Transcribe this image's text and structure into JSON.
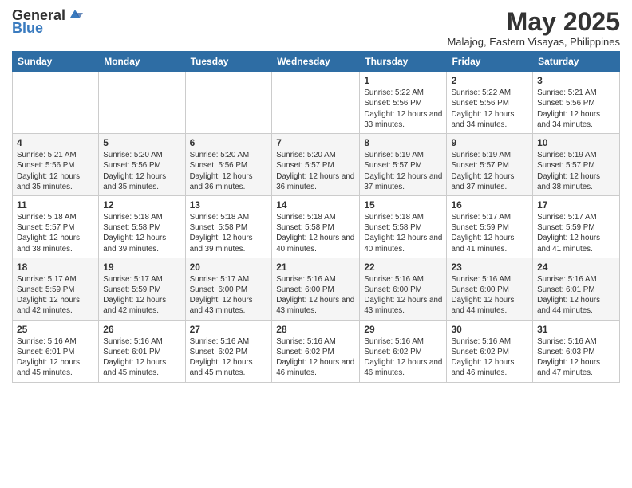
{
  "header": {
    "logo_general": "General",
    "logo_blue": "Blue",
    "title": "May 2025",
    "subtitle": "Malajog, Eastern Visayas, Philippines"
  },
  "days_of_week": [
    "Sunday",
    "Monday",
    "Tuesday",
    "Wednesday",
    "Thursday",
    "Friday",
    "Saturday"
  ],
  "weeks": [
    [
      {
        "day": "",
        "info": ""
      },
      {
        "day": "",
        "info": ""
      },
      {
        "day": "",
        "info": ""
      },
      {
        "day": "",
        "info": ""
      },
      {
        "day": "1",
        "info": "Sunrise: 5:22 AM\nSunset: 5:56 PM\nDaylight: 12 hours and 33 minutes."
      },
      {
        "day": "2",
        "info": "Sunrise: 5:22 AM\nSunset: 5:56 PM\nDaylight: 12 hours and 34 minutes."
      },
      {
        "day": "3",
        "info": "Sunrise: 5:21 AM\nSunset: 5:56 PM\nDaylight: 12 hours and 34 minutes."
      }
    ],
    [
      {
        "day": "4",
        "info": "Sunrise: 5:21 AM\nSunset: 5:56 PM\nDaylight: 12 hours and 35 minutes."
      },
      {
        "day": "5",
        "info": "Sunrise: 5:20 AM\nSunset: 5:56 PM\nDaylight: 12 hours and 35 minutes."
      },
      {
        "day": "6",
        "info": "Sunrise: 5:20 AM\nSunset: 5:56 PM\nDaylight: 12 hours and 36 minutes."
      },
      {
        "day": "7",
        "info": "Sunrise: 5:20 AM\nSunset: 5:57 PM\nDaylight: 12 hours and 36 minutes."
      },
      {
        "day": "8",
        "info": "Sunrise: 5:19 AM\nSunset: 5:57 PM\nDaylight: 12 hours and 37 minutes."
      },
      {
        "day": "9",
        "info": "Sunrise: 5:19 AM\nSunset: 5:57 PM\nDaylight: 12 hours and 37 minutes."
      },
      {
        "day": "10",
        "info": "Sunrise: 5:19 AM\nSunset: 5:57 PM\nDaylight: 12 hours and 38 minutes."
      }
    ],
    [
      {
        "day": "11",
        "info": "Sunrise: 5:18 AM\nSunset: 5:57 PM\nDaylight: 12 hours and 38 minutes."
      },
      {
        "day": "12",
        "info": "Sunrise: 5:18 AM\nSunset: 5:58 PM\nDaylight: 12 hours and 39 minutes."
      },
      {
        "day": "13",
        "info": "Sunrise: 5:18 AM\nSunset: 5:58 PM\nDaylight: 12 hours and 39 minutes."
      },
      {
        "day": "14",
        "info": "Sunrise: 5:18 AM\nSunset: 5:58 PM\nDaylight: 12 hours and 40 minutes."
      },
      {
        "day": "15",
        "info": "Sunrise: 5:18 AM\nSunset: 5:58 PM\nDaylight: 12 hours and 40 minutes."
      },
      {
        "day": "16",
        "info": "Sunrise: 5:17 AM\nSunset: 5:59 PM\nDaylight: 12 hours and 41 minutes."
      },
      {
        "day": "17",
        "info": "Sunrise: 5:17 AM\nSunset: 5:59 PM\nDaylight: 12 hours and 41 minutes."
      }
    ],
    [
      {
        "day": "18",
        "info": "Sunrise: 5:17 AM\nSunset: 5:59 PM\nDaylight: 12 hours and 42 minutes."
      },
      {
        "day": "19",
        "info": "Sunrise: 5:17 AM\nSunset: 5:59 PM\nDaylight: 12 hours and 42 minutes."
      },
      {
        "day": "20",
        "info": "Sunrise: 5:17 AM\nSunset: 6:00 PM\nDaylight: 12 hours and 43 minutes."
      },
      {
        "day": "21",
        "info": "Sunrise: 5:16 AM\nSunset: 6:00 PM\nDaylight: 12 hours and 43 minutes."
      },
      {
        "day": "22",
        "info": "Sunrise: 5:16 AM\nSunset: 6:00 PM\nDaylight: 12 hours and 43 minutes."
      },
      {
        "day": "23",
        "info": "Sunrise: 5:16 AM\nSunset: 6:00 PM\nDaylight: 12 hours and 44 minutes."
      },
      {
        "day": "24",
        "info": "Sunrise: 5:16 AM\nSunset: 6:01 PM\nDaylight: 12 hours and 44 minutes."
      }
    ],
    [
      {
        "day": "25",
        "info": "Sunrise: 5:16 AM\nSunset: 6:01 PM\nDaylight: 12 hours and 45 minutes."
      },
      {
        "day": "26",
        "info": "Sunrise: 5:16 AM\nSunset: 6:01 PM\nDaylight: 12 hours and 45 minutes."
      },
      {
        "day": "27",
        "info": "Sunrise: 5:16 AM\nSunset: 6:02 PM\nDaylight: 12 hours and 45 minutes."
      },
      {
        "day": "28",
        "info": "Sunrise: 5:16 AM\nSunset: 6:02 PM\nDaylight: 12 hours and 46 minutes."
      },
      {
        "day": "29",
        "info": "Sunrise: 5:16 AM\nSunset: 6:02 PM\nDaylight: 12 hours and 46 minutes."
      },
      {
        "day": "30",
        "info": "Sunrise: 5:16 AM\nSunset: 6:02 PM\nDaylight: 12 hours and 46 minutes."
      },
      {
        "day": "31",
        "info": "Sunrise: 5:16 AM\nSunset: 6:03 PM\nDaylight: 12 hours and 47 minutes."
      }
    ]
  ]
}
